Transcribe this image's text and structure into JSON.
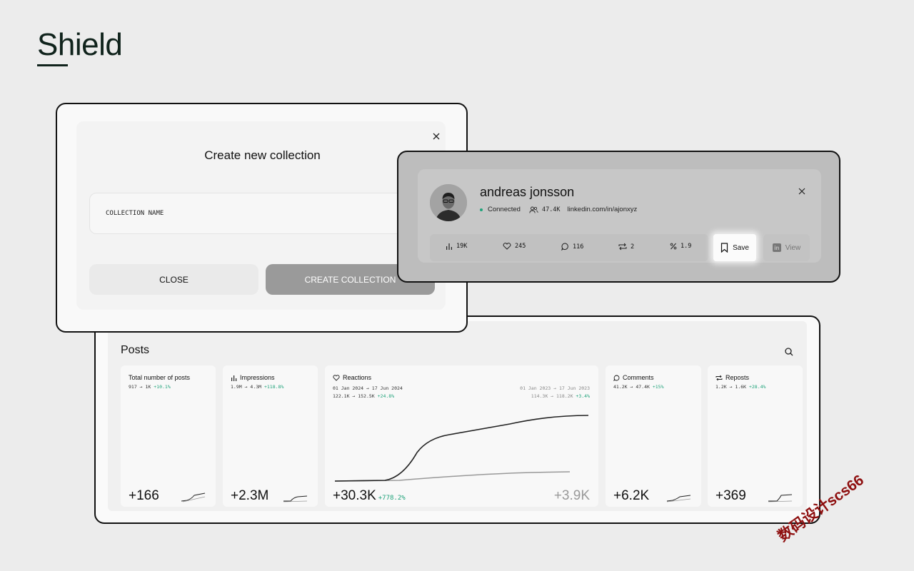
{
  "brand": {
    "name": "Shield"
  },
  "collection_modal": {
    "title": "Create new collection",
    "input_placeholder": "COLLECTION NAME",
    "close_label": "CLOSE",
    "create_label": "CREATE COLLECTION"
  },
  "profile": {
    "name": "andreas jonsson",
    "status": "Connected",
    "followers": "47.4K",
    "linkedin": "linkedin.com/in/ajonxyz",
    "stats": [
      {
        "icon": "bar-chart-icon",
        "value": "19K"
      },
      {
        "icon": "heart-icon",
        "value": "245"
      },
      {
        "icon": "comment-icon",
        "value": "116"
      },
      {
        "icon": "repost-icon",
        "value": "2"
      },
      {
        "icon": "percent-icon",
        "value": "1.9"
      }
    ],
    "save_label": "Save",
    "view_label": "View"
  },
  "posts": {
    "title": "Posts",
    "cards": {
      "total": {
        "title": "Total number of posts",
        "from": "917",
        "to": "1K",
        "change": "+10.1%",
        "big": "+166"
      },
      "impressions": {
        "title": "Impressions",
        "from": "1.9M",
        "to": "4.3M",
        "change": "+118.8%",
        "big": "+2.3M"
      },
      "reactions": {
        "title": "Reactions",
        "range_current": "01 Jan 2024 → 17 Jun 2024",
        "from": "122.1K",
        "to": "152.5K",
        "change": "+24.8%",
        "range_previous": "01 Jan 2023 → 17 Jun 2023",
        "prev_from": "114.3K",
        "prev_to": "118.2K",
        "prev_change": "+3.4%",
        "big": "+30.3K",
        "big_change": "+778.2%",
        "big_previous": "+3.9K"
      },
      "comments": {
        "title": "Comments",
        "from": "41.2K",
        "to": "47.4K",
        "change": "+15%",
        "big": "+6.2K"
      },
      "reposts": {
        "title": "Reposts",
        "from": "1.2K",
        "to": "1.6K",
        "change": "+28.4%",
        "big": "+369"
      }
    }
  },
  "watermark": "数码设计scs66",
  "colors": {
    "positive": "#1fa37a",
    "ink": "#111111",
    "brand": "#10231c",
    "watermark": "#8e0f0f"
  }
}
